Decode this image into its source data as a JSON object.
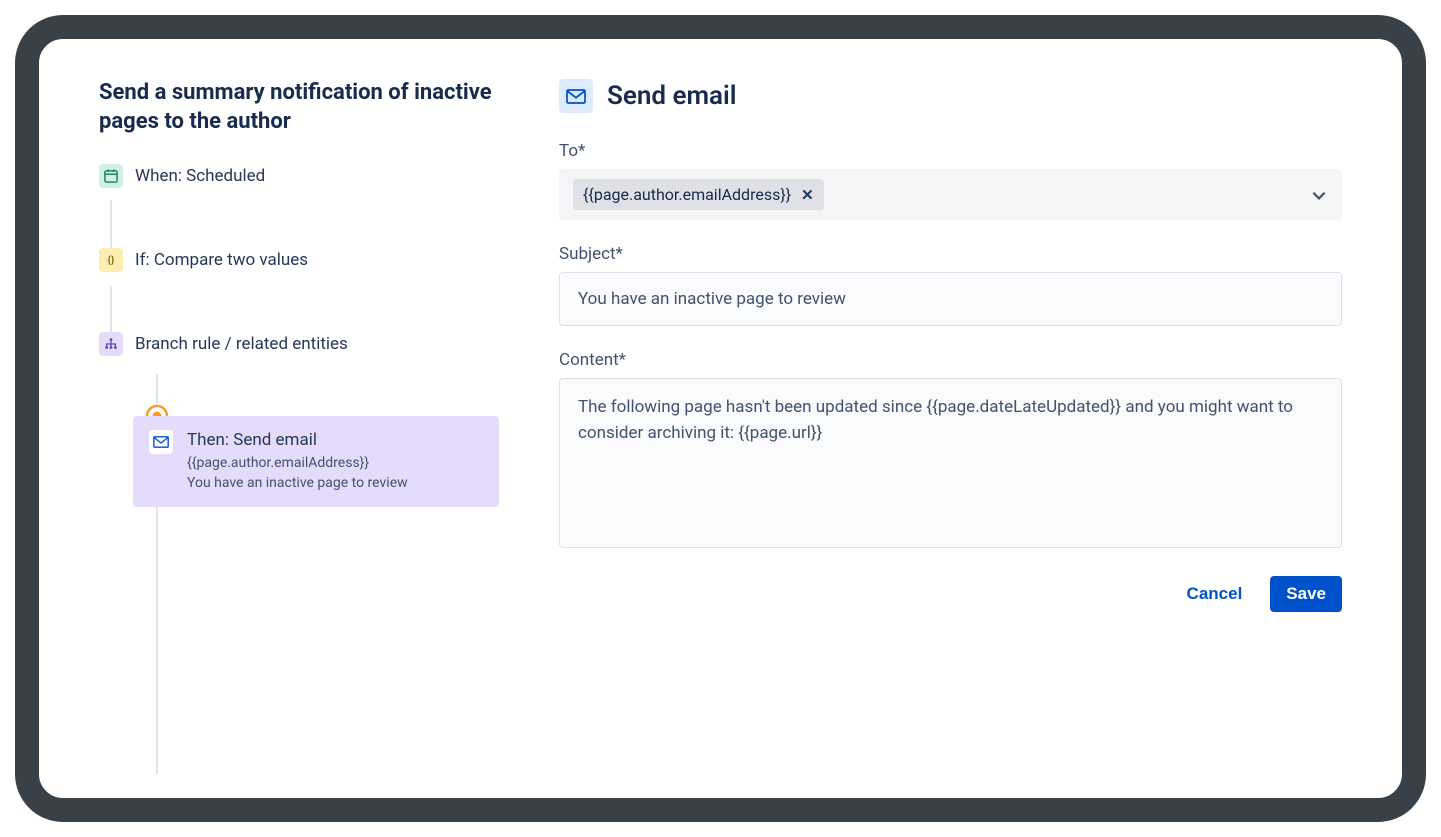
{
  "rule_title": "Send a summary notification of inactive pages to the author",
  "steps": {
    "when": {
      "label": "When: Scheduled"
    },
    "if": {
      "label": "If: Compare two values"
    },
    "branch": {
      "label": "Branch rule / related entities"
    },
    "then": {
      "title": "Then: Send email",
      "line1": "{{page.author.emailAddress}}",
      "line2": "You have an inactive page to review"
    }
  },
  "panel": {
    "title": "Send email",
    "to": {
      "label": "To*",
      "chip": "{{page.author.emailAddress}}"
    },
    "subject": {
      "label": "Subject*",
      "value": "You have an inactive page to review"
    },
    "content": {
      "label": "Content*",
      "value": "The following page hasn't been updated since {{page.dateLateUpdated}} and you might want to consider archiving it: {{page.url}}"
    }
  },
  "actions": {
    "cancel": "Cancel",
    "save": "Save"
  }
}
